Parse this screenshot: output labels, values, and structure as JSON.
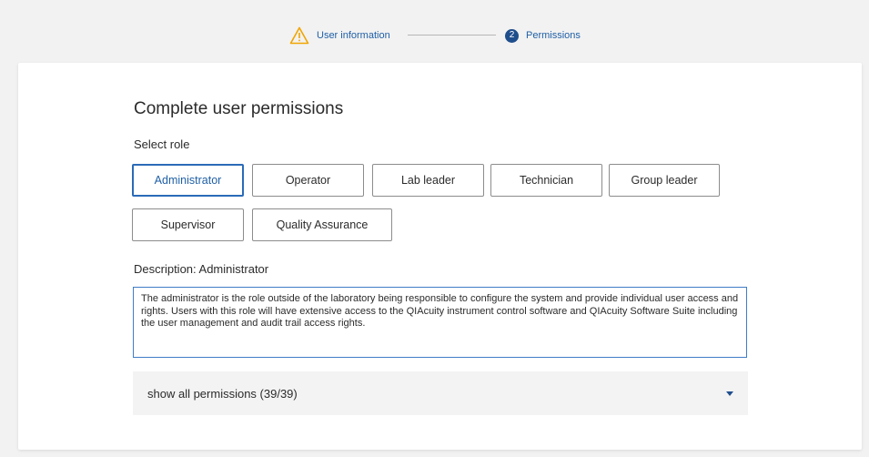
{
  "stepper": {
    "step1_label": "User information",
    "step2_number": "2",
    "step2_label": "Permissions"
  },
  "main": {
    "title": "Complete user permissions",
    "select_role_label": "Select role",
    "roles": [
      {
        "label": "Administrator",
        "selected": true
      },
      {
        "label": "Operator",
        "selected": false
      },
      {
        "label": "Lab leader",
        "selected": false
      },
      {
        "label": "Technician",
        "selected": false
      },
      {
        "label": "Group leader",
        "selected": false
      },
      {
        "label": "Supervisor",
        "selected": false
      },
      {
        "label": "Quality Assurance",
        "selected": false
      }
    ],
    "description_title": "Description: Administrator",
    "description_text": "The administrator is the role outside of the laboratory being responsible to configure the system and provide individual user access and rights. Users with this role will have extensive access to the QIAcuity instrument control software and QIAcuity Software Suite including the user management and audit trail access rights.",
    "permissions_toggle": "show all permissions (39/39)"
  },
  "colors": {
    "accent": "#1f5fa6",
    "warning": "#f0a500",
    "step_circle": "#1f4e8c"
  },
  "icons": {
    "step1": "warning-icon",
    "toggle": "caret-down-icon"
  }
}
